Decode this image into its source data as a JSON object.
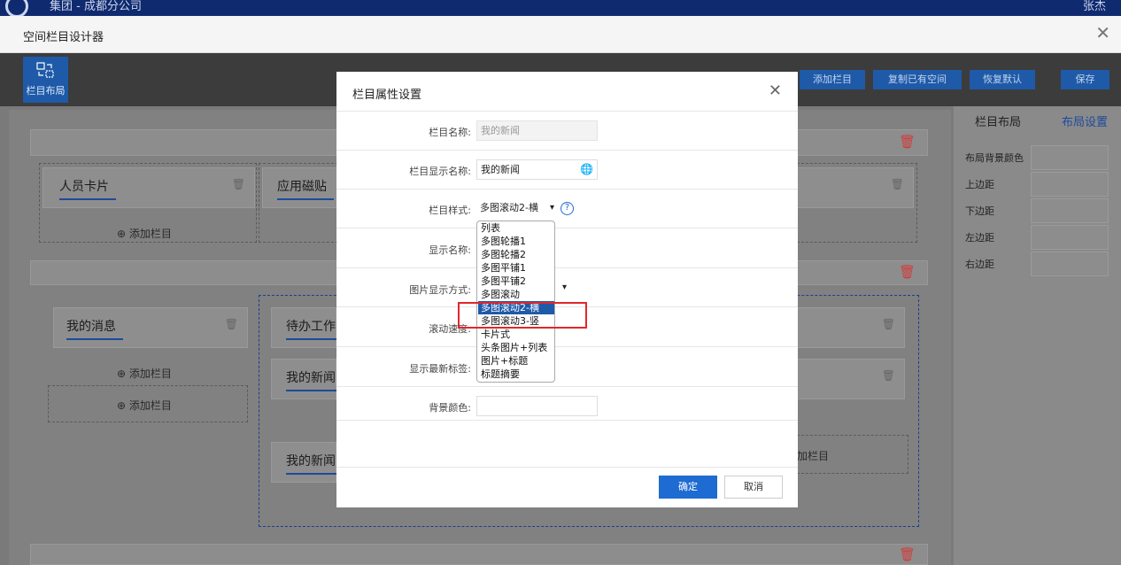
{
  "app": {
    "logo": "app-logo",
    "title": "集团 - 成都分公司",
    "user": "张杰"
  },
  "window": {
    "title": "空间栏目设计器"
  },
  "toolbar": {
    "layout_label": "栏目布局",
    "buttons": [
      "添加栏目",
      "复制已有空间",
      "恢复默认",
      "保存"
    ]
  },
  "right_panel": {
    "tab_layout": "栏目布局",
    "tab_settings": "布局设置",
    "fields": [
      "布局背景颜色",
      "上边距",
      "下边距",
      "左边距",
      "右边距"
    ]
  },
  "canvas": {
    "add_column": "添加栏目",
    "cards": {
      "person_card": "人员卡片",
      "app_tiles": "应用磁贴",
      "my_messages": "我的消息",
      "todo": "待办工作",
      "my_news_1": "我的新闻",
      "my_news_2": "我的新闻",
      "add_column_partial": "加栏目"
    }
  },
  "modal": {
    "title": "栏目属性设置",
    "fields": {
      "name_label": "栏目名称:",
      "name_value": "我的新闻",
      "display_name_label": "栏目显示名称:",
      "display_name_value": "我的新闻",
      "style_label": "栏目样式:",
      "style_value": "多图滚动2-横",
      "show_name_label": "显示名称:",
      "image_mode_label": "图片显示方式:",
      "scroll_speed_label": "滚动速度:",
      "show_new_tag_label": "显示最新标签:",
      "bg_color_label": "背景颜色:"
    },
    "style_options": [
      "列表",
      "多图轮播1",
      "多图轮播2",
      "多图平铺1",
      "多图平铺2",
      "多图滚动",
      "多图滚动2-横",
      "多图滚动3-竖",
      "卡片式",
      "头条图片+列表",
      "图片+标题",
      "标题摘要"
    ],
    "selected_option": "多图滚动2-横",
    "ok": "确定",
    "cancel": "取消"
  },
  "colors": {
    "accent": "#1e6bd1",
    "highlight": "#e2262b",
    "delete": "#d43c3c"
  }
}
